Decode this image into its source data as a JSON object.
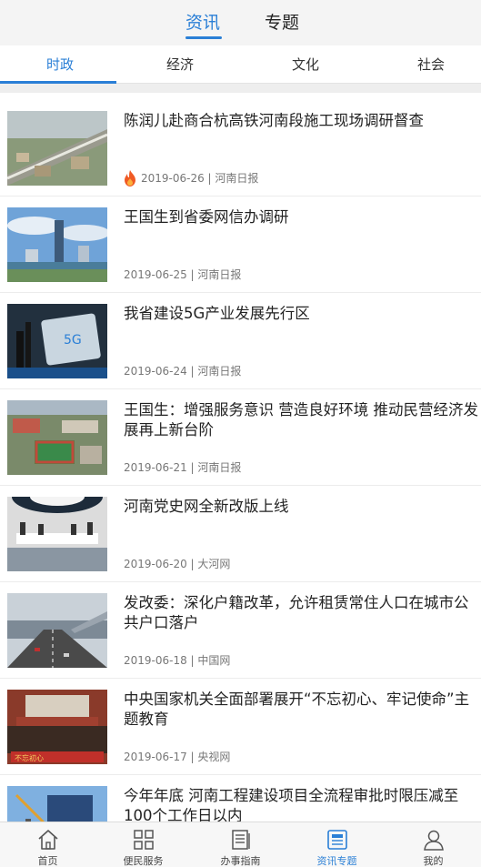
{
  "top_tabs": [
    {
      "label": "资讯",
      "active": true
    },
    {
      "label": "专题",
      "active": false
    }
  ],
  "category_tabs": [
    {
      "label": "时政",
      "active": true
    },
    {
      "label": "经济",
      "active": false
    },
    {
      "label": "文化",
      "active": false
    },
    {
      "label": "社会",
      "active": false
    }
  ],
  "colors": {
    "accent": "#2a7fd6",
    "hot": "#f05a24"
  },
  "news": [
    {
      "title": "陈润儿赴商合杭高铁河南段施工现场调研督查",
      "meta": "2019-06-26 | 河南日报",
      "hot": true
    },
    {
      "title": "王国生到省委网信办调研",
      "meta": "2019-06-25 | 河南日报",
      "hot": false
    },
    {
      "title": "我省建设5G产业发展先行区",
      "meta": "2019-06-24 | 河南日报",
      "hot": false
    },
    {
      "title": "王国生：增强服务意识 营造良好环境 推动民营经济发展再上新台阶",
      "meta": "2019-06-21 | 河南日报",
      "hot": false
    },
    {
      "title": "河南党史网全新改版上线",
      "meta": "2019-06-20 | 大河网",
      "hot": false
    },
    {
      "title": "发改委：深化户籍改革，允许租赁常住人口在城市公共户口落户",
      "meta": "2019-06-18 | 中国网",
      "hot": false
    },
    {
      "title": "中央国家机关全面部署展开“不忘初心、牢记使命”主题教育",
      "meta": "2019-06-17 | 央视网",
      "hot": false
    },
    {
      "title": "今年年底 河南工程建设项目全流程审批时限压减至100个工作日以内",
      "meta": "",
      "hot": false
    }
  ],
  "bottom_nav": [
    {
      "label": "首页",
      "icon": "home-icon",
      "active": false
    },
    {
      "label": "便民服务",
      "icon": "grid-icon",
      "active": false
    },
    {
      "label": "办事指南",
      "icon": "document-icon",
      "active": false
    },
    {
      "label": "资讯专题",
      "icon": "news-icon",
      "active": true
    },
    {
      "label": "我的",
      "icon": "user-icon",
      "active": false
    }
  ]
}
